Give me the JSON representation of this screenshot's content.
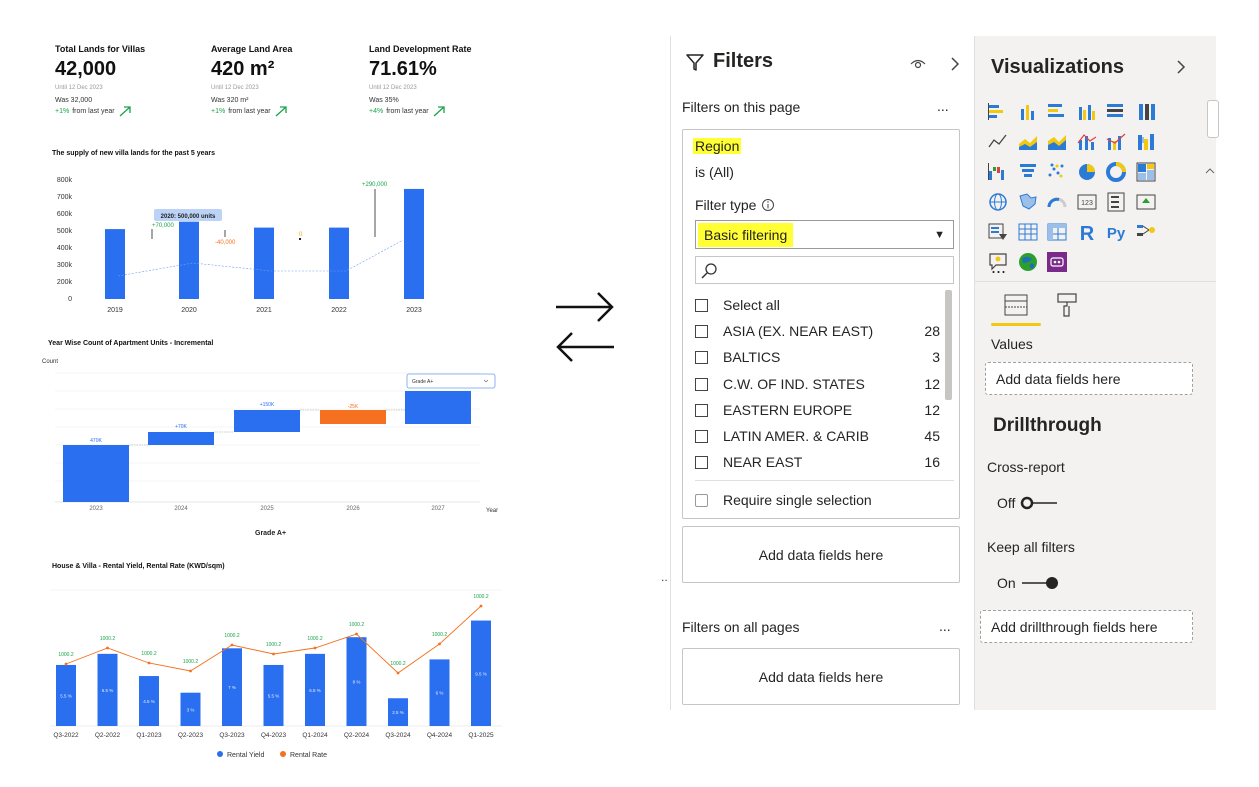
{
  "kpis": [
    {
      "title": "Total Lands for Villas",
      "value": "42,000",
      "until": "Until 12 Dec 2023",
      "was": "Was 32,000",
      "pct": "+1%",
      "change_text": "from last year"
    },
    {
      "title": "Average Land Area",
      "value": "420 m²",
      "until": "Until 12 Dec 2023",
      "was": "Was 320 m²",
      "pct": "+1%",
      "change_text": "from last year"
    },
    {
      "title": "Land Development Rate",
      "value": "71.61%",
      "until": "Until 12 Dec 2023",
      "was": "Was 35%",
      "pct": "+4%",
      "change_text": "from last year"
    }
  ],
  "chart1": {
    "title": "The supply of new villa lands for the past 5 years",
    "yticks": [
      "800k",
      "700k",
      "600k",
      "500k",
      "400k",
      "300k",
      "200k",
      "0"
    ],
    "tooltip": "2020: 500,000 units",
    "annotations": [
      "+70,000",
      "-40,000",
      "0",
      "+290,000"
    ]
  },
  "chart2": {
    "title": "Year Wise Count of Apartment Units - Incremental",
    "ylabel": "Count",
    "xlabel": "Year",
    "legend_title": "Grade A+",
    "dropdown_value": "Grade A+"
  },
  "chart3": {
    "title": "House & Villa - Rental Yield, Rental Rate (KWD/sqm)",
    "legend": [
      "Rental Yield",
      "Rental Rate"
    ]
  },
  "chart_data": [
    {
      "type": "bar",
      "title": "The supply of new villa lands for the past 5 years",
      "categories": [
        "2019",
        "2020",
        "2021",
        "2022",
        "2023"
      ],
      "values": [
        470000,
        520000,
        480000,
        480000,
        740000
      ],
      "ylim": [
        0,
        800000
      ]
    },
    {
      "type": "bar",
      "title": "Year Wise Count of Apartment Units - Incremental",
      "categories": [
        "2023",
        "2024",
        "2025",
        "2026",
        "2027"
      ],
      "labels": [
        "470K",
        "+70K",
        "+150K",
        "-25K",
        ""
      ],
      "colors": [
        "#2a6ff0",
        "#2a6ff0",
        "#2a6ff0",
        "#f5701f",
        "#2a6ff0"
      ]
    },
    {
      "type": "bar",
      "title": "House & Villa - Rental Yield, Rental Rate (KWD/sqm)",
      "categories": [
        "Q3-2022",
        "Q2-2022",
        "Q1-2023",
        "Q2-2023",
        "Q3-2023",
        "Q4-2023",
        "Q1-2024",
        "Q2-2024",
        "Q3-2024",
        "Q4-2024",
        "Q1-2025"
      ],
      "series": [
        {
          "name": "Rental Yield",
          "labels": [
            "5.5 %",
            "6.5 %",
            "4.5 %",
            "3 %",
            "7 %",
            "5.5 %",
            "6.5 %",
            "8 %",
            "2.5 %",
            "6 %",
            "9.5 %"
          ],
          "values": [
            5.5,
            6.5,
            4.5,
            3,
            7,
            5.5,
            6.5,
            8,
            2.5,
            6,
            9.5
          ]
        },
        {
          "name": "Rental Rate",
          "labels": [
            "1000.2",
            "1000.2",
            "1000.2",
            "1000.2",
            "1000.2",
            "1000.2",
            "1000.2",
            "1000.2",
            "1000.2",
            "1000.2",
            "1000.2"
          ],
          "values": [
            1000.2,
            1000.2,
            1000.2,
            1000.2,
            1000.2,
            1000.2,
            1000.2,
            1000.2,
            1000.2,
            1000.2,
            1000.2
          ]
        }
      ]
    }
  ],
  "filters": {
    "title": "Filters",
    "on_this_page": "Filters on this page",
    "field_name": "Region",
    "field_state": "is (All)",
    "filter_type_label": "Filter type",
    "filter_type_value": "Basic filtering",
    "search_placeholder": "",
    "select_all": "Select all",
    "items": [
      {
        "label": "ASIA (EX. NEAR EAST)",
        "count": "28"
      },
      {
        "label": "BALTICS",
        "count": "3"
      },
      {
        "label": "C.W. OF IND. STATES",
        "count": "12"
      },
      {
        "label": "EASTERN EUROPE",
        "count": "12"
      },
      {
        "label": "LATIN AMER. & CARIB",
        "count": "45"
      },
      {
        "label": "NEAR EAST",
        "count": "16"
      }
    ],
    "require_single": "Require single selection",
    "add_fields": "Add data fields here",
    "on_all_pages": "Filters on all pages",
    "add_fields_all": "Add data fields here",
    "more": "..."
  },
  "visualizations": {
    "title": "Visualizations",
    "values_label": "Values",
    "add_values": "Add data fields here",
    "drillthrough": "Drillthrough",
    "cross_report": "Cross-report",
    "cross_report_state": "Off",
    "keep_filters": "Keep all filters",
    "keep_filters_state": "On",
    "add_drill": "Add drillthrough fields here",
    "more_visuals": "...",
    "r_label": "R",
    "py_label": "Py",
    "number_label": "123"
  },
  "colors": {
    "bar_blue": "#2a6ff0",
    "orange": "#f5701f",
    "green": "#1aa34a",
    "highlight": "#ffff33"
  }
}
